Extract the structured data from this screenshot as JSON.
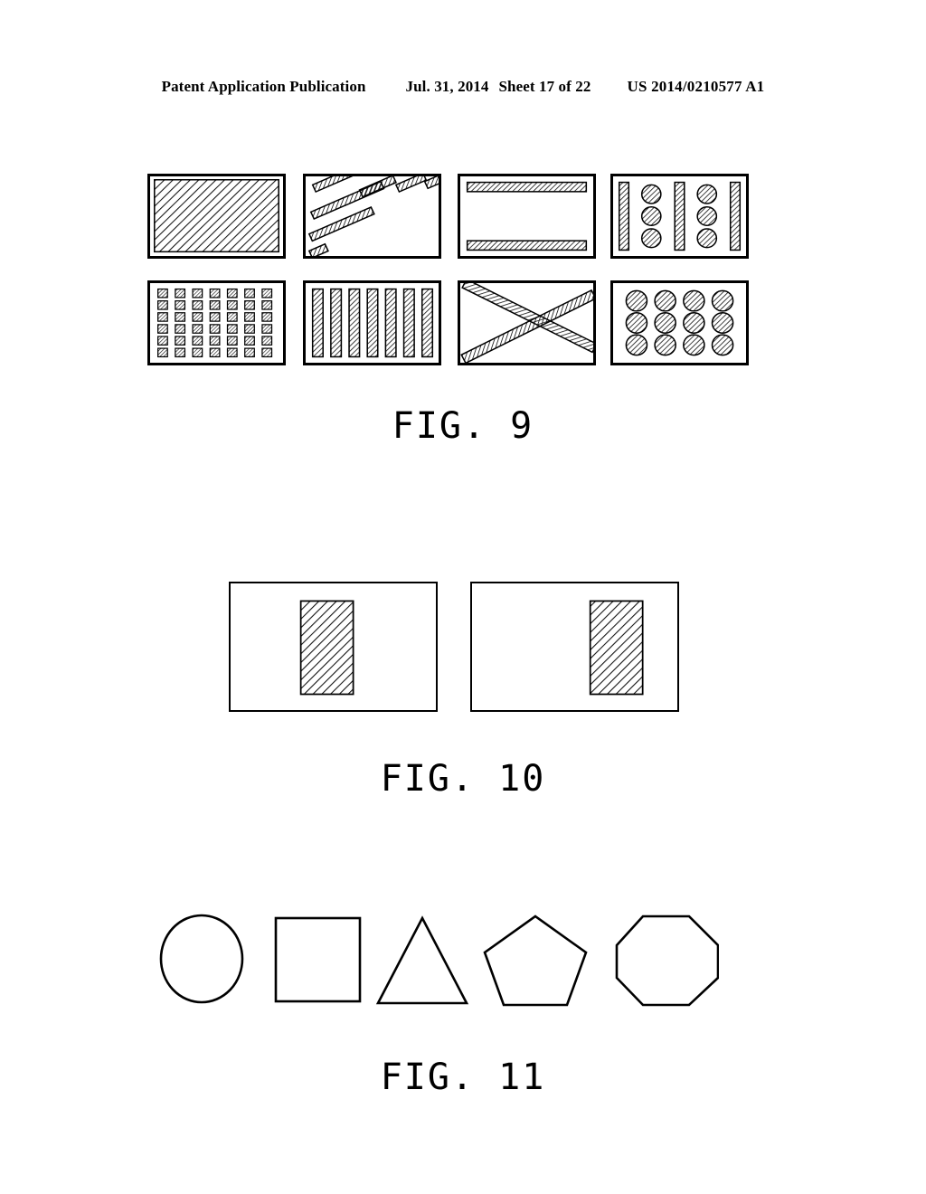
{
  "header": {
    "publication": "Patent Application Publication",
    "date": "Jul. 31, 2014",
    "sheet": "Sheet 17 of 22",
    "doc_number": "US 2014/0210577 A1"
  },
  "colors": {
    "ink": "#000000",
    "paper": "#ffffff",
    "hatch": "#1a1a1a"
  },
  "figures": [
    {
      "id": "fig9",
      "caption": "FIG. 9",
      "description": "Eight rectangular electrode-pattern panels arranged in a 4 by 2 grid, each showing a different hatched conductive layout.",
      "panels": [
        {
          "index": 1,
          "name": "full-hatched-plate",
          "pattern": "solid-hatch-fill",
          "row": 1,
          "col": 1,
          "elements": 1
        },
        {
          "index": 2,
          "name": "diagonal-bars",
          "pattern": "staggered-diagonal-bars",
          "row": 1,
          "col": 2,
          "elements": 7
        },
        {
          "index": 3,
          "name": "horizontal-edge-bars",
          "pattern": "two-horizontal-bars",
          "row": 1,
          "col": 3,
          "elements": 2
        },
        {
          "index": 4,
          "name": "bars-and-circles",
          "pattern": "vertical-bars-with-circle-columns",
          "row": 1,
          "col": 4,
          "elements": 9
        },
        {
          "index": 5,
          "name": "square-dot-matrix",
          "pattern": "grid-of-hatched-squares",
          "row": 2,
          "col": 1,
          "elements": 42
        },
        {
          "index": 6,
          "name": "vertical-bars",
          "pattern": "seven-vertical-bars",
          "row": 2,
          "col": 2,
          "elements": 7
        },
        {
          "index": 7,
          "name": "crossed-diagonal-bars",
          "pattern": "x-cross",
          "row": 2,
          "col": 3,
          "elements": 2
        },
        {
          "index": 8,
          "name": "circle-matrix",
          "pattern": "grid-of-hatched-circles",
          "row": 2,
          "col": 4,
          "elements": 12
        }
      ]
    },
    {
      "id": "fig10",
      "caption": "FIG. 10",
      "description": "Two rectangular panels each containing one hatched rectangular region at a different lateral position.",
      "panels": [
        {
          "index": 1,
          "name": "centered-block-panel",
          "block_position": "center"
        },
        {
          "index": 2,
          "name": "right-offset-block-panel",
          "block_position": "right"
        }
      ]
    },
    {
      "id": "fig11",
      "caption": "FIG. 11",
      "description": "Five outline geometric shapes shown in a row.",
      "shapes": [
        {
          "index": 1,
          "name": "circle",
          "sides": 0
        },
        {
          "index": 2,
          "name": "square",
          "sides": 4
        },
        {
          "index": 3,
          "name": "triangle",
          "sides": 3
        },
        {
          "index": 4,
          "name": "pentagon",
          "sides": 5
        },
        {
          "index": 5,
          "name": "octagon",
          "sides": 8
        }
      ]
    }
  ]
}
